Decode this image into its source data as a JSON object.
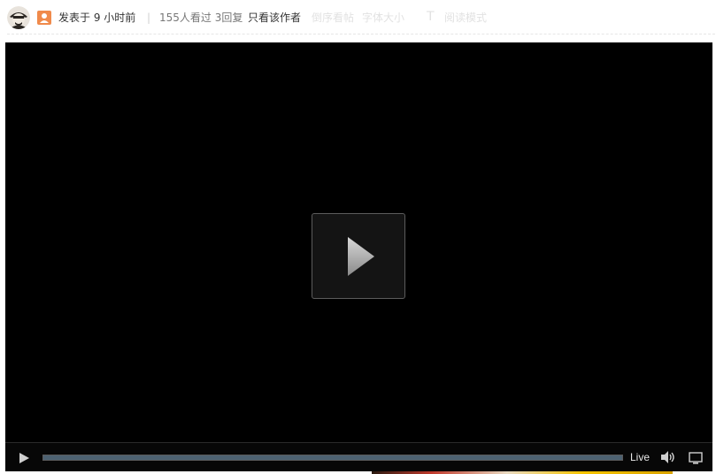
{
  "post_meta": {
    "posted_time": "发表于 9 小时前",
    "separator": "|",
    "stats": "155人看过 3回复",
    "only_author": "只看该作者",
    "reverse_view": "倒序看帖",
    "font_size": "字体大小",
    "font_icon_glyph": "T",
    "reading_mode": "阅读模式"
  },
  "video_player": {
    "live_label": "Live",
    "progress_fraction": 1.0
  },
  "colors": {
    "video_bg": "#000000",
    "progress_fill": "#4d6272",
    "badge": "#f08a4b"
  },
  "icons": [
    "avatar",
    "user-badge-icon",
    "font-size-icon",
    "big-play-icon",
    "play-icon",
    "volume-icon",
    "fullscreen-icon"
  ]
}
